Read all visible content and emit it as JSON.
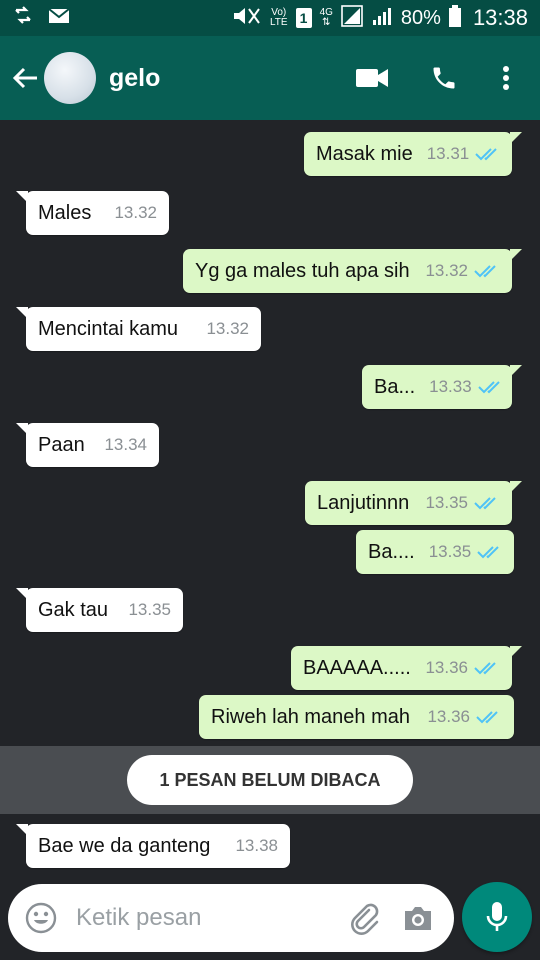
{
  "statusbar": {
    "volte_top": "Vo)",
    "volte_bottom": "LTE",
    "sim": "1",
    "network": "4G",
    "battery": "80%",
    "time": "13:38"
  },
  "header": {
    "contact_name": "gelo",
    "icons": [
      "back-arrow-icon",
      "video-call-icon",
      "phone-icon",
      "more-vert-icon"
    ]
  },
  "messages": [
    {
      "dir": "out",
      "text": "Masak mie",
      "time": "13.31",
      "status": "read"
    },
    {
      "dir": "in",
      "text": "Males",
      "time": "13.32"
    },
    {
      "dir": "out",
      "text": "Yg ga males tuh apa sih",
      "time": "13.32",
      "status": "read"
    },
    {
      "dir": "in",
      "text": "Mencintai kamu",
      "time": "13.32"
    },
    {
      "dir": "out",
      "text": "Ba...",
      "time": "13.33",
      "status": "read"
    },
    {
      "dir": "in",
      "text": "Paan",
      "time": "13.34"
    },
    {
      "dir": "out",
      "text": "Lanjutinnn",
      "time": "13.35",
      "status": "read"
    },
    {
      "dir": "out",
      "text": "Ba....",
      "time": "13.35",
      "status": "read"
    },
    {
      "dir": "in",
      "text": "Gak tau",
      "time": "13.35"
    },
    {
      "dir": "out",
      "text": "BAAAAA.....",
      "time": "13.36",
      "status": "read"
    },
    {
      "dir": "out",
      "text": "Riweh lah maneh mah",
      "time": "13.36",
      "status": "read"
    }
  ],
  "unread_banner": "1 PESAN BELUM DIBACA",
  "unread_messages": [
    {
      "dir": "in",
      "text": "Bae we da ganteng",
      "time": "13.38"
    }
  ],
  "input": {
    "placeholder": "Ketik pesan"
  },
  "colors": {
    "appbar": "#075e54",
    "statusbar": "#054d44",
    "outgoing_bubble": "#dcf8c6",
    "incoming_bubble": "#ffffff",
    "read_ticks": "#4fc3f7",
    "mic_button": "#00897b"
  }
}
